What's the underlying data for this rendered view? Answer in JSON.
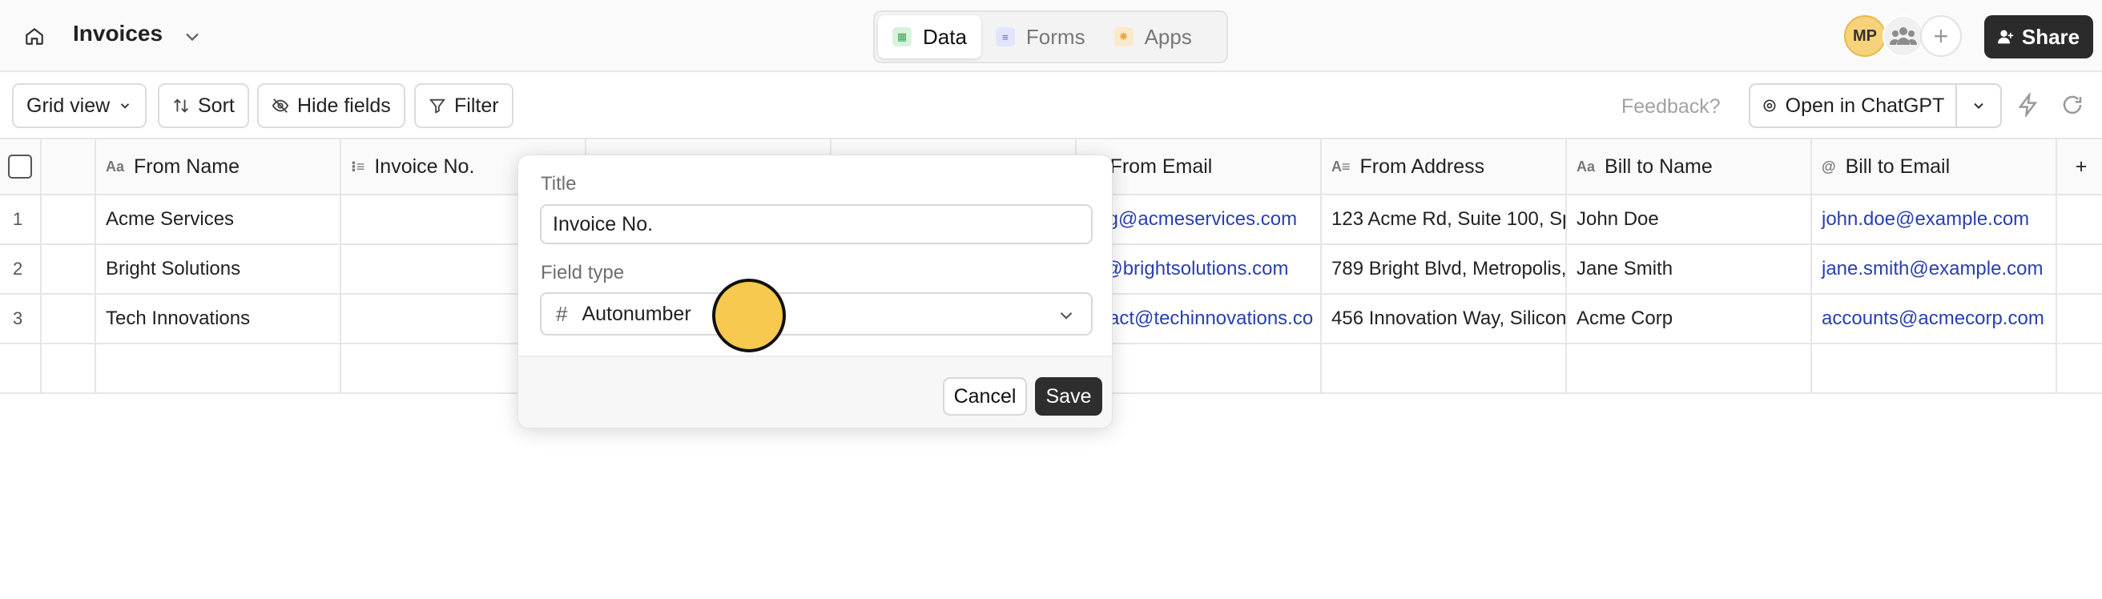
{
  "header": {
    "title": "Invoices",
    "tabs": [
      {
        "label": "Data",
        "icon": "table-icon",
        "active": true,
        "color": "#3aa757"
      },
      {
        "label": "Forms",
        "icon": "form-icon",
        "active": false,
        "color": "#4a6bd8"
      },
      {
        "label": "Apps",
        "icon": "apps-icon",
        "active": false,
        "color": "#e8a23a"
      }
    ],
    "avatar_initials": "MP",
    "share_label": "Share"
  },
  "toolbar": {
    "view_label": "Grid view",
    "sort_label": "Sort",
    "hide_fields_label": "Hide fields",
    "filter_label": "Filter",
    "feedback_label": "Feedback?",
    "open_chatgpt_label": "Open in ChatGPT"
  },
  "table": {
    "columns": [
      {
        "label": "From Name",
        "icon": "Aa"
      },
      {
        "label": "Invoice No.",
        "icon": "list"
      },
      {
        "label": "",
        "icon": ""
      },
      {
        "label": "",
        "icon": ""
      },
      {
        "label": "From Email",
        "icon": "@"
      },
      {
        "label": "From Address",
        "icon": "text"
      },
      {
        "label": "Bill to Name",
        "icon": "Aa"
      },
      {
        "label": "Bill to Email",
        "icon": "@"
      }
    ],
    "add_column_label": "+",
    "rows": [
      {
        "num": "1",
        "cells": [
          "Acme Services",
          "",
          "",
          "",
          "ing@acmeservices.com",
          "123 Acme Rd, Suite 100, Sp",
          "John Doe",
          "john.doe@example.com"
        ]
      },
      {
        "num": "2",
        "cells": [
          "Bright Solutions",
          "",
          "",
          "",
          "o@brightsolutions.com",
          "789 Bright Blvd, Metropolis,",
          "Jane Smith",
          "jane.smith@example.com"
        ]
      },
      {
        "num": "3",
        "cells": [
          "Tech Innovations",
          "",
          "",
          "",
          "ntact@techinnovations.co",
          "456 Innovation Way, Silicon",
          "Acme Corp",
          "accounts@acmecorp.com"
        ]
      }
    ]
  },
  "popover": {
    "title_label": "Title",
    "title_value": "Invoice No.",
    "field_type_label": "Field type",
    "field_type_value": "Autonumber",
    "cancel_label": "Cancel",
    "save_label": "Save"
  }
}
